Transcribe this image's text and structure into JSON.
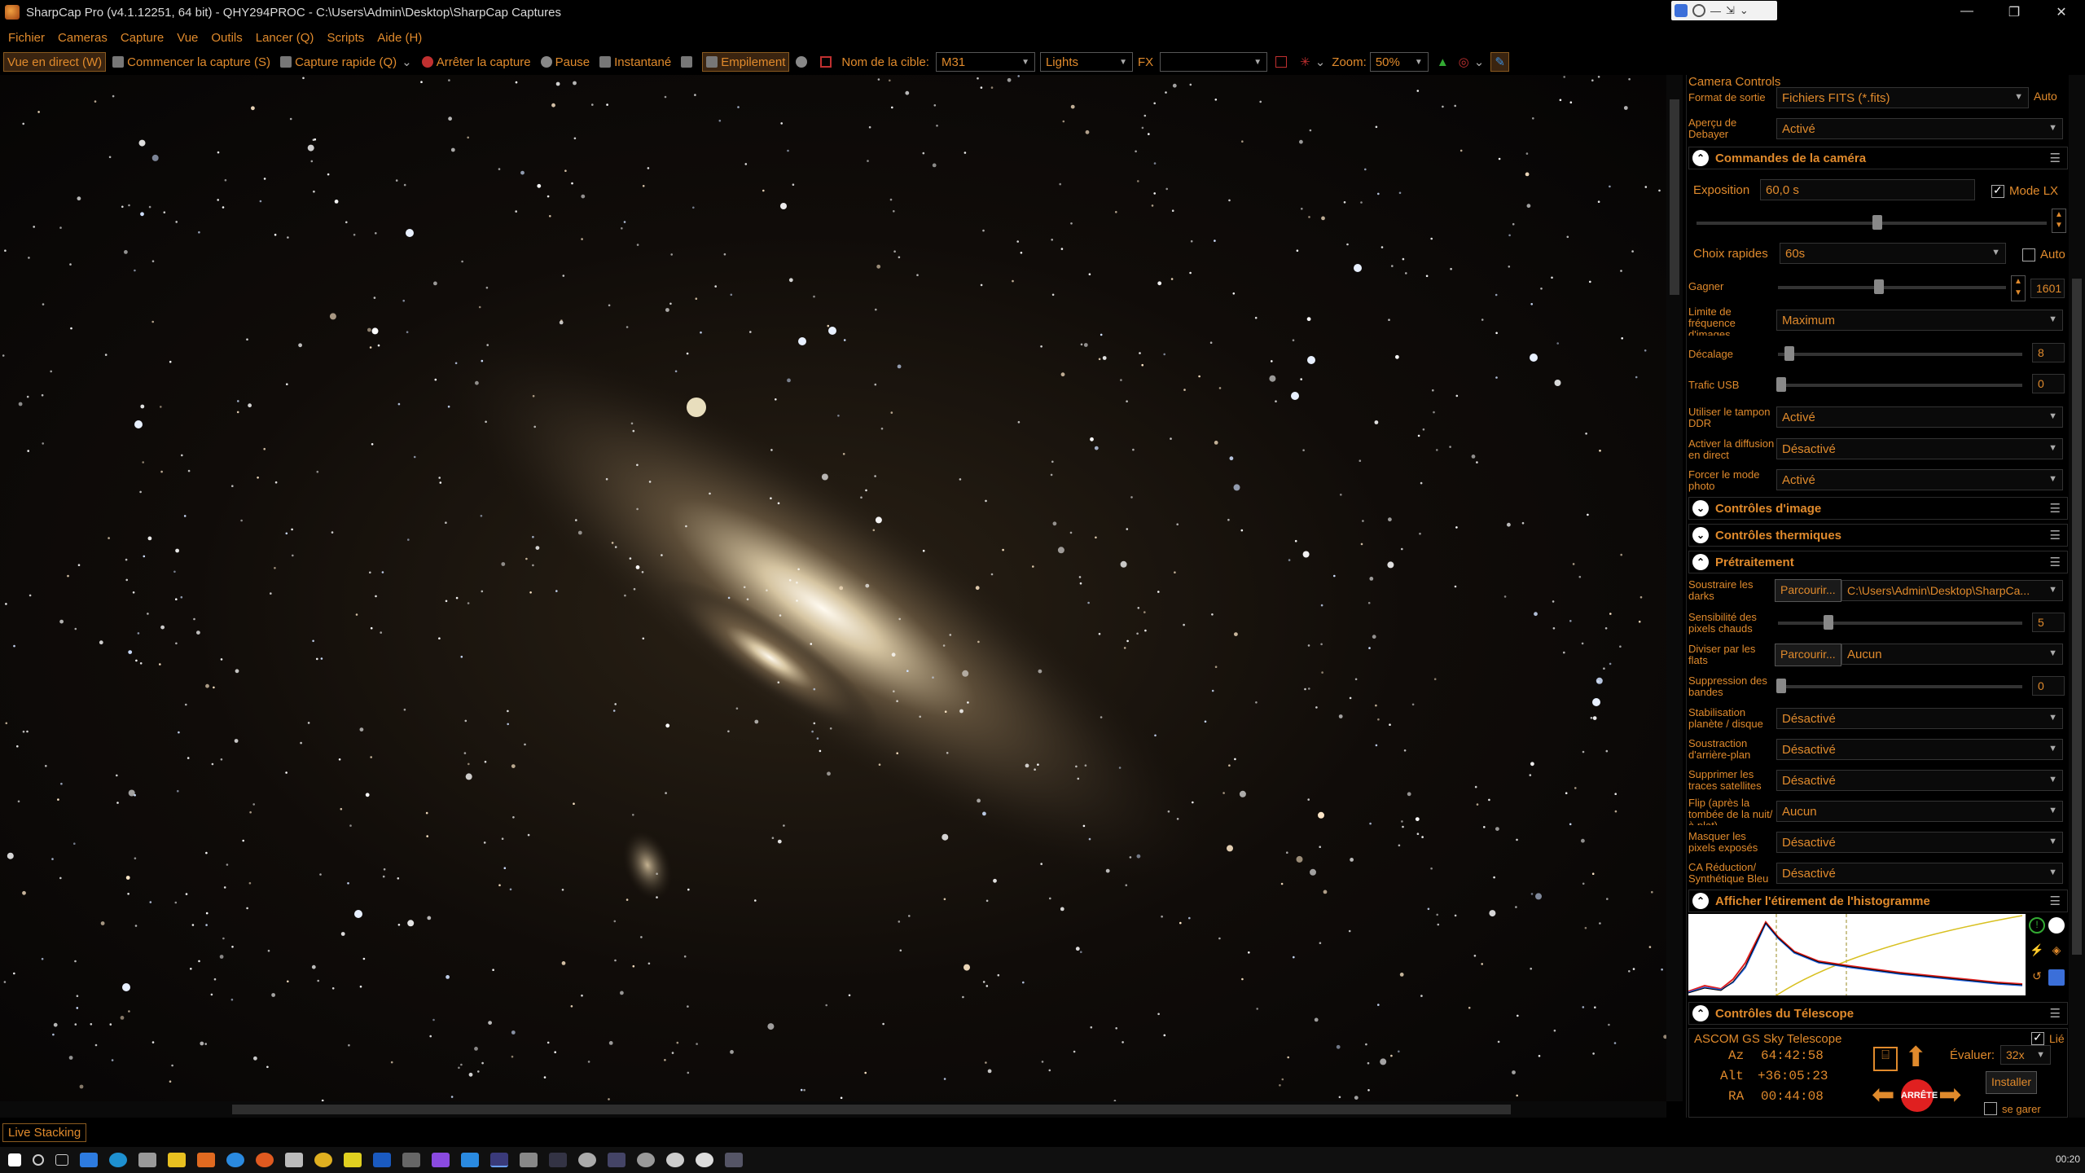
{
  "window": {
    "title": "SharpCap Pro (v4.1.12251, 64 bit) - QHY294PROC - C:\\Users\\Admin\\Desktop\\SharpCap Captures",
    "controls": [
      "—",
      "❐",
      "✕"
    ]
  },
  "menu": [
    "Fichier",
    "Cameras",
    "Capture",
    "Vue",
    "Outils",
    "Lancer (Q)",
    "Scripts",
    "Aide (H)"
  ],
  "toolbar": {
    "live_view": "Vue en direct (W)",
    "start_capture": "Commencer la capture (S)",
    "quick_capture": "Capture rapide (Q)",
    "stop_capture": "Arrêter la capture",
    "pause": "Pause",
    "snapshot": "Instantané",
    "stacking": "Empilement",
    "target_label": "Nom de la cible:",
    "target_value": "M31",
    "frame_type": "Lights",
    "fx_label": "FX",
    "fx_value": "",
    "zoom_label": "Zoom:",
    "zoom_value": "50%"
  },
  "status": {
    "live_stacking": "Live Stacking"
  },
  "taskbar": {
    "clock": "00:20"
  },
  "panel": {
    "title": "Camera Controls",
    "output_format_label": "Format de sortie",
    "output_format_value": "Fichiers FITS (*.fits)",
    "output_format_auto": "Auto",
    "debayer_label": "Aperçu de Debayer",
    "debayer_value": "Activé",
    "camera_section": "Commandes de la caméra",
    "exposure_label": "Exposition",
    "exposure_value": "60,0 s",
    "lx_mode": "Mode LX",
    "quick_choices_label": "Choix rapides",
    "quick_choices_value": "60s",
    "quick_auto": "Auto",
    "gain_label": "Gagner",
    "gain_value": "1601",
    "frame_limit_label": "Limite de fréquence d'images",
    "frame_limit_value": "Maximum",
    "offset_label": "Décalage",
    "offset_value": "8",
    "usb_label": "Trafic USB",
    "usb_value": "0",
    "ddr_label": "Utiliser le tampon DDR",
    "ddr_value": "Activé",
    "live_broadcast_label": "Activer la diffusion en direct",
    "live_broadcast_value": "Désactivé",
    "photo_mode_label": "Forcer le mode photo",
    "photo_mode_value": "Activé",
    "image_section": "Contrôles d'image",
    "thermal_section": "Contrôles thermiques",
    "preprocess_section": "Prétraitement",
    "darks_label": "Soustraire les darks",
    "browse": "Parcourir...",
    "darks_path": "C:\\Users\\Admin\\Desktop\\SharpCa...",
    "hotpix_label": "Sensibilité des pixels chauds",
    "hotpix_value": "5",
    "flats_label": "Diviser par les flats",
    "flats_value": "Aucun",
    "banding_label": "Suppression des bandes",
    "banding_value": "0",
    "stab_label": "Stabilisation planète / disque",
    "stab_value": "Désactivé",
    "bg_label": "Soustraction d'arrière-plan",
    "bg_value": "Désactivé",
    "sat_label": "Supprimer les traces satellites",
    "sat_value": "Désactivé",
    "flip_label": "Flip (après la tombée de la nuit/à plat)",
    "flip_value": "Aucun",
    "mask_label": "Masquer les pixels exposés",
    "mask_value": "Désactivé",
    "ca_label": "CA Réduction/ Synthétique Bleu",
    "ca_value": "Désactivé",
    "histo_section": "Afficher l'étirement de l'histogramme",
    "telescope_section": "Contrôles du Télescope",
    "telescope_name": "ASCOM GS Sky Telescope",
    "linked": "Lié",
    "az_label": "Az",
    "az_value": "64:42:58",
    "alt_label": "Alt",
    "alt_value": "+36:05:23",
    "ra_label": "RA",
    "ra_value": "00:44:08",
    "rate_label": "Évaluer:",
    "rate_value": "32x",
    "install": "Installer",
    "stop": "ARRÊTE",
    "park": "se garer"
  }
}
